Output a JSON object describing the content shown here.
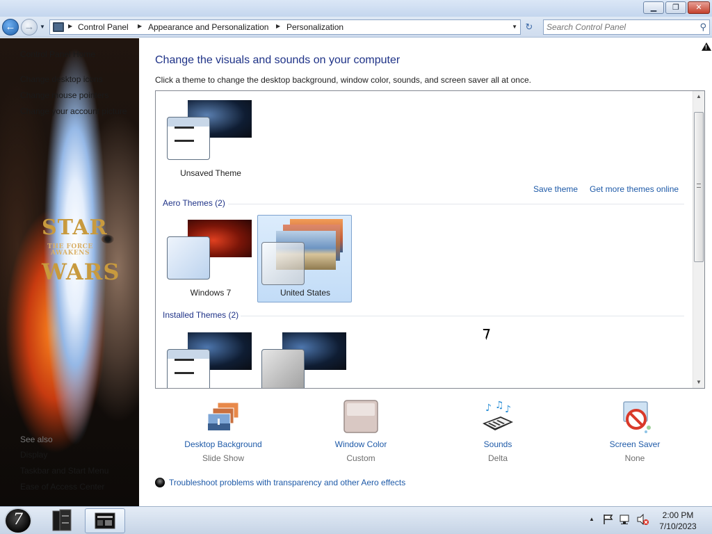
{
  "window": {
    "minimize_icon": "minimize-icon",
    "maximize_icon": "restore-icon",
    "close_icon": "close-icon",
    "minimize_glyph": "▁",
    "maximize_glyph": "❐",
    "close_glyph": "✕"
  },
  "navigation": {
    "back_glyph": "←",
    "forward_glyph": "→",
    "breadcrumbs": [
      "Control Panel",
      "Appearance and Personalization",
      "Personalization"
    ],
    "search_placeholder": "Search Control Panel",
    "refresh_glyph": "↻"
  },
  "sidebar": {
    "home": "Control Panel Home",
    "links": [
      "Change desktop icons",
      "Change mouse pointers",
      "Change your account picture"
    ],
    "see_also_title": "See also",
    "see_also": [
      "Display",
      "Taskbar and Start Menu",
      "Ease of Access Center"
    ],
    "wallpaper": {
      "logo_star": "STAR",
      "logo_tagline": "THE FORCE AWAKENS",
      "logo_wars": "WARS"
    }
  },
  "main": {
    "heading": "Change the visuals and sounds on your computer",
    "subheading": "Click a theme to change the desktop background, window color, sounds, and screen saver all at once.",
    "my_themes": [
      {
        "label": "Unsaved Theme"
      }
    ],
    "save_theme": "Save theme",
    "get_more": "Get more themes online",
    "aero_title": "Aero Themes (2)",
    "aero_themes": [
      {
        "label": "Windows 7",
        "selected": false
      },
      {
        "label": "United States",
        "selected": true
      }
    ],
    "installed_title": "Installed Themes (2)",
    "installed_themes": [
      {
        "label": ""
      },
      {
        "label": ""
      }
    ]
  },
  "settings": [
    {
      "title": "Desktop Background",
      "value": "Slide Show",
      "icon": "desktop-background-icon"
    },
    {
      "title": "Window Color",
      "value": "Custom",
      "icon": "window-color-icon"
    },
    {
      "title": "Sounds",
      "value": "Delta",
      "icon": "sounds-icon"
    },
    {
      "title": "Screen Saver",
      "value": "None",
      "icon": "screen-saver-icon"
    }
  ],
  "troubleshoot": "Troubleshoot problems with transparency and other Aero effects",
  "taskbar": {
    "tray_arrow": "▲",
    "time": "2:00 PM",
    "date": "7/10/2023"
  },
  "colors": {
    "accent": "#1e3287",
    "link": "#1e5aa8",
    "selection": "#c2dcf7"
  }
}
